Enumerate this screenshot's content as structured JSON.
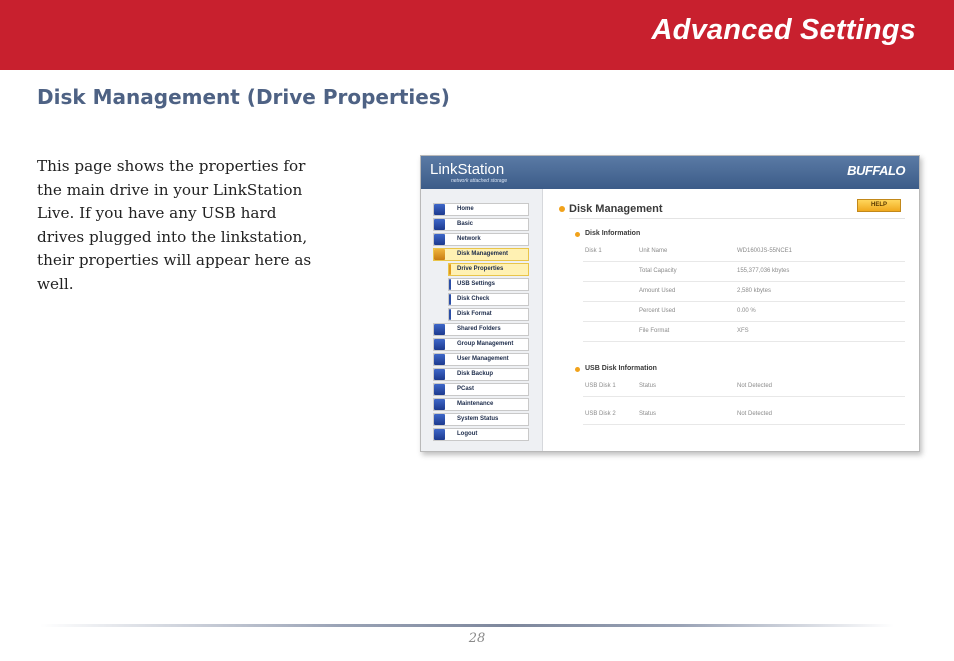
{
  "banner": {
    "title": "Advanced Settings",
    "color": "#c8202e"
  },
  "section_title": "Disk Management (Drive Properties)",
  "body_lines": [
    "This page shows the properties for",
    "the main drive in your LinkStation",
    "Live.  If you have any USB hard",
    "drives plugged into the linkstation,",
    "their properties will appear here as",
    "well."
  ],
  "screenshot": {
    "logo": "LinkStation",
    "tagline": "network attached storage",
    "brand": "BUFFALO",
    "nav": [
      {
        "label": "Home",
        "icon": "home-icon"
      },
      {
        "label": "Basic",
        "icon": "basic-icon"
      },
      {
        "label": "Network",
        "icon": "network-icon"
      },
      {
        "label": "Disk Management",
        "icon": "disk-icon",
        "active": true
      },
      {
        "label": "Drive Properties",
        "sub": true,
        "active": true
      },
      {
        "label": "USB Settings",
        "sub": true
      },
      {
        "label": "Disk Check",
        "sub": true
      },
      {
        "label": "Disk Format",
        "sub": true
      },
      {
        "label": "Shared Folders",
        "icon": "folder-icon"
      },
      {
        "label": "Group Management",
        "icon": "group-icon"
      },
      {
        "label": "User Management",
        "icon": "user-icon"
      },
      {
        "label": "Disk Backup",
        "icon": "backup-icon"
      },
      {
        "label": "PCast",
        "icon": "pcast-icon"
      },
      {
        "label": "Maintenance",
        "icon": "maintenance-icon"
      },
      {
        "label": "System Status",
        "icon": "status-icon"
      },
      {
        "label": "Logout",
        "icon": "logout-icon"
      }
    ],
    "main_title": "Disk Management",
    "help_label": "HELP",
    "disk_info_title": "Disk Information",
    "disk_label": "Disk 1",
    "disk_rows": [
      {
        "key": "Unit Name",
        "value": "WD1600JS-55NCE1"
      },
      {
        "key": "Total Capacity",
        "value": "155,377,036 kbytes"
      },
      {
        "key": "Amount Used",
        "value": "2,580 kbytes"
      },
      {
        "key": "Percent Used",
        "value": "0.00 %"
      },
      {
        "key": "File Format",
        "value": "XFS"
      }
    ],
    "usb_info_title": "USB Disk Information",
    "usb_rows": [
      {
        "disk": "USB Disk 1",
        "key": "Status",
        "value": "Not Detected"
      },
      {
        "disk": "USB Disk 2",
        "key": "Status",
        "value": "Not Detected"
      }
    ]
  },
  "page_number": "28"
}
